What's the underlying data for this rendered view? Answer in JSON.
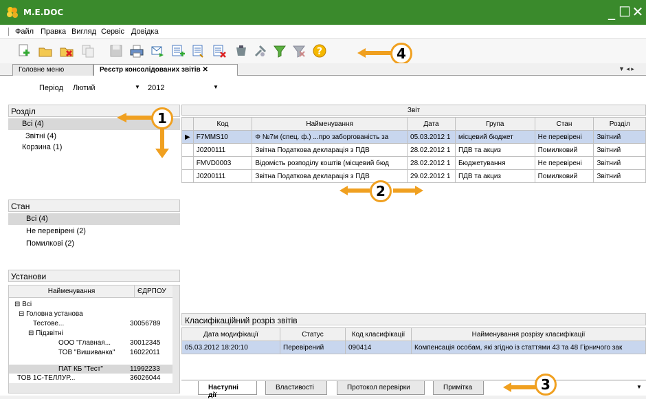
{
  "window": {
    "title": "M.E.DOC"
  },
  "menu": [
    "Файл",
    "Правка",
    "Вигляд",
    "Сервіс",
    "Довідка"
  ],
  "toolbar_icons": [
    "new-doc-icon",
    "open-folder-icon",
    "delete-doc-icon",
    "copy-doc-icon",
    "save-icon",
    "print-icon",
    "email-icon",
    "add-list-icon",
    "list-icon",
    "remove-list-icon",
    "bag-icon",
    "tools-icon",
    "filter-icon",
    "clear-filter-icon",
    "help-icon"
  ],
  "tabs": [
    {
      "label": "Головне меню"
    },
    {
      "label": "Реєстр консолідованих звітів"
    }
  ],
  "period": {
    "label": "Період",
    "month": "Лютий",
    "year": "2012"
  },
  "razdil": {
    "title": "Розділ",
    "items": [
      "Всі (4)",
      "Звітні (4)",
      "Корзина (1)"
    ]
  },
  "stan": {
    "title": "Стан",
    "items": [
      "Всі (4)",
      "Не перевірені (2)",
      "Помилкові (2)"
    ]
  },
  "ustanovy": {
    "title": "Установи",
    "headers": [
      "Найменування",
      "ЄДРПОУ"
    ],
    "rows": [
      {
        "name": "⊟ Всі",
        "code": ""
      },
      {
        "name": "⊟ Головна установа",
        "code": ""
      },
      {
        "name": "Тестове...",
        "code": "30056789"
      },
      {
        "name": "⊟ Підзвітні",
        "code": ""
      },
      {
        "name": "ООО \"Главная...",
        "code": "30012345"
      },
      {
        "name": "ТОВ \"Вишиванка\"",
        "code": "16022011"
      },
      {
        "name": "ПАТ КБ \"Тест\"",
        "code": "11992233"
      },
      {
        "name": "ТОВ 1С-ТЕЛЛУР...",
        "code": "36026044"
      }
    ]
  },
  "reports": {
    "group_header": "Звіт",
    "headers": [
      "Код",
      "Найменування",
      "Дата",
      "Група",
      "Стан",
      "Розділ"
    ],
    "rows": [
      [
        "F7MMS10",
        "Ф №7м (спец. ф.) ...про заборгованість за",
        "05.03.2012 1",
        "місцевий бюджет",
        "Не перевірені",
        "Звітний"
      ],
      [
        "J0200111",
        "Звітна Податкова декларація з ПДВ",
        "28.02.2012 1",
        "ПДВ та акциз",
        "Помилковий",
        "Звітний"
      ],
      [
        "FMVD0003",
        "Відомість розподілу коштів (місцевий бюд",
        "28.02.2012 1",
        "Бюджетування",
        "Не перевірені",
        "Звітний"
      ],
      [
        "J0200111",
        "Звітна Податкова декларація з ПДВ",
        "29.02.2012 1",
        "ПДВ та акциз",
        "Помилковий",
        "Звітний"
      ]
    ]
  },
  "classification": {
    "title": "Класифікаційний розріз звітів",
    "headers": [
      "Дата модифікації",
      "Статус",
      "Код класифікації",
      "Найменування розрізу класифікації"
    ],
    "rows": [
      [
        "05.03.2012 18:20:10",
        "Перевірений",
        "090414",
        "Компенсація особам, які згідно із статтями 43 та 48 Гірничого зак"
      ]
    ]
  },
  "bottom_tabs": [
    "Наступні дії",
    "Властивості",
    "Протокол перевірки",
    "Примітка"
  ],
  "callouts": [
    "1",
    "2",
    "3",
    "4"
  ],
  "colors": {
    "titlebar": "#3a8a2c",
    "callout": "#f0a020",
    "selected_row": "#c8d6ee"
  }
}
